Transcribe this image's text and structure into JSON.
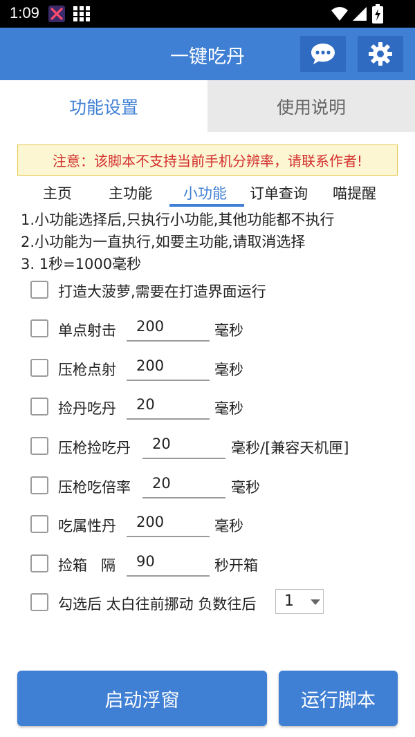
{
  "status_bar": {
    "time": "1:09",
    "icons": [
      "x-app-icon",
      "grid-icon",
      "wifi-icon",
      "signal-icon",
      "battery-icon"
    ]
  },
  "app_bar": {
    "title": "一键吃丹",
    "icons": [
      "chat-icon",
      "gear-icon"
    ],
    "color": "#3f7fd4"
  },
  "tabs": [
    {
      "label": "功能设置",
      "selected": true
    },
    {
      "label": "使用说明",
      "selected": false
    }
  ],
  "warning": "注意：该脚本不支持当前手机分辨率，请联系作者!",
  "subtabs": [
    {
      "label": "主页"
    },
    {
      "label": "主功能"
    },
    {
      "label": "小功能",
      "selected": true
    },
    {
      "label": "订单查询"
    },
    {
      "label": "喵提醒"
    }
  ],
  "notes": [
    "1.小功能选择后,只执行小功能,其他功能都不执行",
    "2.小功能为一直执行,如要主功能,请取消选择",
    "3. 1秒=1000毫秒"
  ],
  "options": [
    {
      "label": "打造大菠萝,需要在打造界面运行",
      "checked": false
    },
    {
      "label": "单点射击",
      "value": "200",
      "unit": "毫秒",
      "checked": false
    },
    {
      "label": "压枪点射",
      "value": "200",
      "unit": "毫秒",
      "checked": false
    },
    {
      "label": "捡丹吃丹",
      "value": "20",
      "unit": "毫秒",
      "checked": false
    },
    {
      "label": "压枪捡吃丹",
      "value": "20",
      "unit": "毫秒/[兼容天机匣]",
      "checked": false
    },
    {
      "label": "压枪吃倍率",
      "value": "20",
      "unit": "毫秒",
      "checked": false
    },
    {
      "label": "吃属性丹",
      "value": "200",
      "unit": "毫秒",
      "checked": false
    },
    {
      "label": "捡箱   隔",
      "value": "90",
      "unit": "秒开箱",
      "checked": false
    },
    {
      "label": "勾选后 太白往前挪动 负数往后",
      "select_value": "1",
      "checked": false
    }
  ],
  "buttons": {
    "float": "启动浮窗",
    "run": "运行脚本"
  }
}
